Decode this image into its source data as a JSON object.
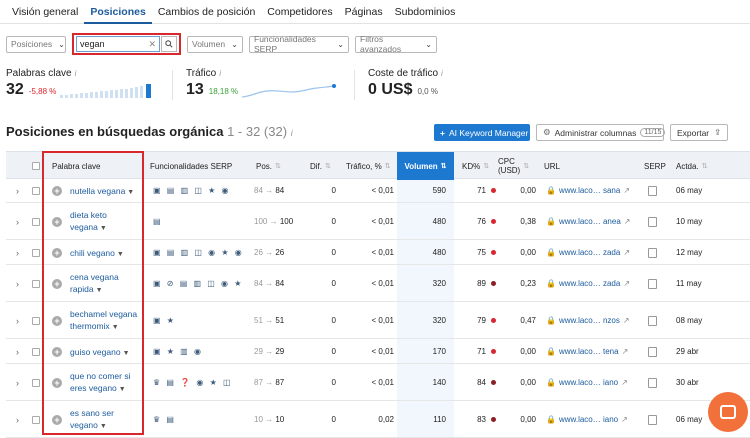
{
  "tabs": [
    {
      "label": "Visión general",
      "active": false
    },
    {
      "label": "Posiciones",
      "active": true
    },
    {
      "label": "Cambios de posición",
      "active": false
    },
    {
      "label": "Competidores",
      "active": false
    },
    {
      "label": "Páginas",
      "active": false
    },
    {
      "label": "Subdominios",
      "active": false
    }
  ],
  "filters": {
    "positions": "Posiciones",
    "search_value": "vegan",
    "volume": "Volumen",
    "serp_features": "Funcionalidades SERP",
    "advanced": "Filtros avanzados"
  },
  "metrics": {
    "keywords": {
      "label": "Palabras clave",
      "value": "32",
      "change": "-5,88 %"
    },
    "traffic": {
      "label": "Tráfico",
      "value": "13",
      "change": "18,18 %"
    },
    "traffic_cost": {
      "label": "Coste de tráfico",
      "value": "0 US$",
      "change": "0,0 %"
    }
  },
  "section": {
    "title": "Posiciones en búsquedas orgánica",
    "range": "1 - 32 (32)",
    "ai_button": "AI Keyword Manager",
    "manage_columns": "Administrar columnas",
    "columns_badge": "11/15",
    "export": "Exportar"
  },
  "columns": {
    "keyword": "Palabra clave",
    "serp_features": "Funcionalidades SERP",
    "pos": "Pos.",
    "diff": "Dif.",
    "traffic": "Tráfico, %",
    "volume": "Volumen",
    "kd": "KD%",
    "cpc": "CPC\n(USD)",
    "url": "URL",
    "serp": "SERP",
    "updated": "Actda."
  },
  "rows": [
    {
      "keyword": "nutella vegana",
      "serp": "▣ ▤ ▥ ◫ ★ ◉",
      "pos_prev": "84",
      "pos": "84",
      "diff": "0",
      "traffic": "< 0,01",
      "volume": "590",
      "kd": "71",
      "kd_dark": false,
      "cpc": "0,00",
      "url": "www.laco… sana",
      "updated": "06 may"
    },
    {
      "keyword": "dieta keto vegana",
      "serp": "▤",
      "pos_prev": "100",
      "pos": "100",
      "diff": "0",
      "traffic": "< 0,01",
      "volume": "480",
      "kd": "76",
      "kd_dark": false,
      "cpc": "0,38",
      "url": "www.laco… anea",
      "updated": "10 may"
    },
    {
      "keyword": "chili vegano",
      "serp": "▣ ▤ ▥ ◫ ◉ ★ ◉",
      "pos_prev": "26",
      "pos": "26",
      "diff": "0",
      "traffic": "< 0,01",
      "volume": "480",
      "kd": "75",
      "kd_dark": false,
      "cpc": "0,00",
      "url": "www.laco… zada",
      "updated": "12 may"
    },
    {
      "keyword": "cena vegana rapida",
      "serp": "▣ ⊘ ▤ ▥ ◫ ◉ ★",
      "pos_prev": "84",
      "pos": "84",
      "diff": "0",
      "traffic": "< 0,01",
      "volume": "320",
      "kd": "89",
      "kd_dark": true,
      "cpc": "0,23",
      "url": "www.laco… zada",
      "updated": "11 may"
    },
    {
      "keyword": "bechamel vegana thermomix",
      "serp": "▣ ★",
      "pos_prev": "51",
      "pos": "51",
      "diff": "0",
      "traffic": "< 0,01",
      "volume": "320",
      "kd": "79",
      "kd_dark": false,
      "cpc": "0,47",
      "url": "www.laco… nzos",
      "updated": "08 may"
    },
    {
      "keyword": "guiso vegano",
      "serp": "▣ ★ ▥ ◉",
      "pos_prev": "29",
      "pos": "29",
      "diff": "0",
      "traffic": "< 0,01",
      "volume": "170",
      "kd": "71",
      "kd_dark": false,
      "cpc": "0,00",
      "url": "www.laco… tena",
      "updated": "29 abr"
    },
    {
      "keyword": "que no comer si eres vegano",
      "serp": "♛ ▤ ❓ ◉ ★ ◫",
      "pos_prev": "87",
      "pos": "87",
      "diff": "0",
      "traffic": "< 0,01",
      "volume": "140",
      "kd": "84",
      "kd_dark": true,
      "cpc": "0,00",
      "url": "www.laco… iano",
      "updated": "30 abr"
    },
    {
      "keyword": "es sano ser vegano",
      "serp": "♛ ▤",
      "pos_prev": "10",
      "pos": "10",
      "diff": "0",
      "traffic": "0,02",
      "volume": "110",
      "kd": "83",
      "kd_dark": true,
      "cpc": "0,00",
      "url": "www.laco… iano",
      "updated": "06 may"
    }
  ]
}
